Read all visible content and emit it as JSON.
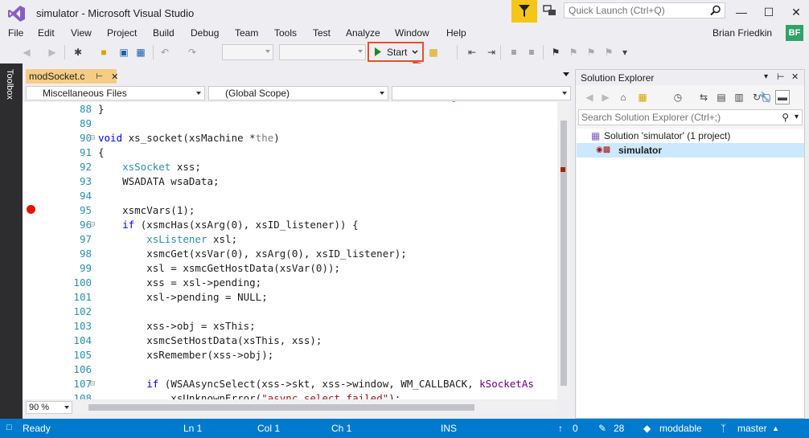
{
  "window": {
    "title": "simulator - Microsoft Visual Studio",
    "quick_launch_placeholder": "Quick Launch (Ctrl+Q)"
  },
  "menu": [
    "File",
    "Edit",
    "View",
    "Project",
    "Build",
    "Debug",
    "Team",
    "Tools",
    "Test",
    "Analyze",
    "Window",
    "Help"
  ],
  "user": {
    "name": "Brian Friedkin",
    "initials": "BF"
  },
  "toolbar": {
    "start_label": "Start"
  },
  "toolbox": {
    "label": "Toolbox"
  },
  "editor": {
    "tab_title": "modSocket.c",
    "nav": {
      "project": "Miscellaneous Files",
      "scope": "(Global Scope)",
      "member": ""
    },
    "zoom": "90 %",
    "breakpoint_line": "95",
    "lines": [
      {
        "n": "88",
        "code": "}"
      },
      {
        "n": "89",
        "code": ""
      },
      {
        "n": "90",
        "code": "void xs_socket(xsMachine *the)"
      },
      {
        "n": "91",
        "code": "{"
      },
      {
        "n": "92",
        "code": "    xsSocket xss;"
      },
      {
        "n": "93",
        "code": "    WSADATA wsaData;"
      },
      {
        "n": "94",
        "code": ""
      },
      {
        "n": "95",
        "code": "    xsmcVars(1);"
      },
      {
        "n": "96",
        "code": "    if (xsmcHas(xsArg(0), xsID_listener)) {"
      },
      {
        "n": "97",
        "code": "        xsListener xsl;"
      },
      {
        "n": "98",
        "code": "        xsmcGet(xsVar(0), xsArg(0), xsID_listener);"
      },
      {
        "n": "99",
        "code": "        xsl = xsmcGetHostData(xsVar(0));"
      },
      {
        "n": "100",
        "code": "        xss = xsl->pending;"
      },
      {
        "n": "101",
        "code": "        xsl->pending = NULL;"
      },
      {
        "n": "102",
        "code": ""
      },
      {
        "n": "103",
        "code": "        xss->obj = xsThis;"
      },
      {
        "n": "104",
        "code": "        xsmcSetHostData(xsThis, xss);"
      },
      {
        "n": "105",
        "code": "        xsRemember(xss->obj);"
      },
      {
        "n": "106",
        "code": ""
      },
      {
        "n": "107",
        "code": "        if (WSAAsyncSelect(xss->skt, xss->window, WM_CALLBACK, kSocketAs"
      },
      {
        "n": "108",
        "code": "            xsUnknownError(\"async select failed\");"
      }
    ]
  },
  "solution_explorer": {
    "title": "Solution Explorer",
    "search_placeholder": "Search Solution Explorer (Ctrl+;)",
    "solution_label": "Solution 'simulator' (1 project)",
    "project_label": "simulator"
  },
  "statusbar": {
    "ready": "Ready",
    "ln": "Ln 1",
    "col": "Col 1",
    "ch": "Ch 1",
    "ins": "INS",
    "up_count": "0",
    "pending_count": "28",
    "repo": "moddable",
    "branch": "master"
  },
  "colors": {
    "accent": "#007acc",
    "tab_active": "#f5cc84",
    "annotation": "#e5502a"
  }
}
